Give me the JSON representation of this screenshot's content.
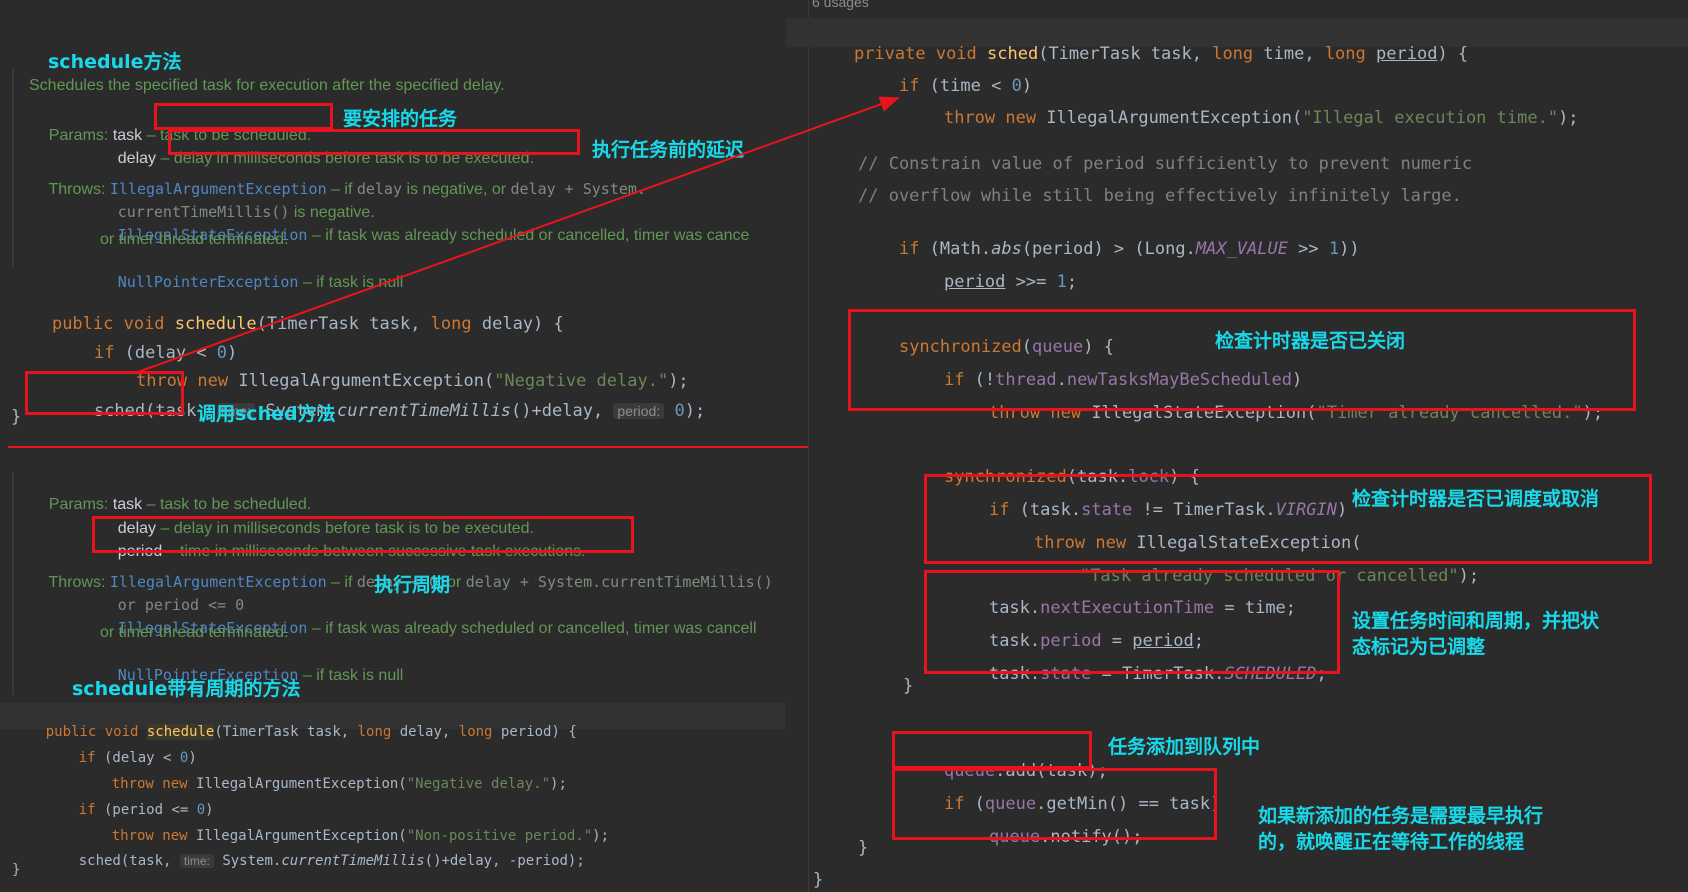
{
  "left": {
    "title1": "schedule方法",
    "doc1": {
      "summary": "Schedules the specified task for execution after the specified delay.",
      "params_label": "Params:",
      "p_task_name": "task",
      "p_task_desc": "task to be scheduled.",
      "p_delay_name": "delay",
      "p_delay_desc": "delay in milliseconds before task is to be executed.",
      "throws_label": "Throws:",
      "t1_name": "IllegalArgumentException",
      "t1_desc_a": " – if ",
      "t1_desc_b": "delay",
      "t1_desc_c": " is negative, or ",
      "t1_desc_d": "delay + System.",
      "t1_desc_e": "currentTimeMillis()",
      "t1_desc_f": " is negative.",
      "t2_name": "IllegalStateException",
      "t2_desc": " – if task was already scheduled or cancelled, timer was cance",
      "t2_desc2": "or timer thread terminated.",
      "t3_name": "NullPointerException",
      "t3_desc": " – if task is null"
    },
    "ann_task": "要安排的任务",
    "ann_delay": "执行任务前的延迟",
    "ann_sched": "调用sched方法",
    "code1": {
      "l1_a": "public void ",
      "l1_b": "schedule",
      "l1_c": "(TimerTask task, ",
      "l1_d": "long",
      "l1_e": " delay) {",
      "l2_a": "if",
      "l2_b": " (delay < ",
      "l2_c": "0",
      "l2_d": ")",
      "l3_a": "throw new ",
      "l3_b": "IllegalArgumentException(",
      "l3_c": "\"Negative delay.\"",
      "l3_d": ");",
      "l4_a": "sched(task,",
      "l4_hint_time": "time:",
      "l4_b": "System.",
      "l4_c": "currentTimeMillis",
      "l4_d": "()+delay,",
      "l4_hint_period": "period:",
      "l4_e": "0",
      "l4_f": ");",
      "l5": "}"
    },
    "doc2": {
      "params_label": "Params:",
      "p_task_name": "task",
      "p_task_desc": " – task to be scheduled.",
      "p_delay_name": "delay",
      "p_delay_desc": " – delay in milliseconds before task is to be executed.",
      "p_period_name": "period",
      "p_period_desc": " – time in milliseconds between successive task executions.",
      "throws_label": "Throws:",
      "t1_name": "IllegalArgumentException",
      "t1_desc_a": " – if ",
      "t1_desc_b": "delay < 0",
      "t1_desc_c": ", or ",
      "t1_desc_d": "delay + System.currentTimeMillis()",
      "t1_desc_e": "or period <= 0",
      "t2_name": "IllegalStateException",
      "t2_desc": " – if task was already scheduled or cancelled, timer was cancell",
      "t2_desc2": "or timer thread terminated.",
      "t3_name": "NullPointerException",
      "t3_desc": " – if task is null"
    },
    "ann_period": "执行周期",
    "title2": "schedule带有周期的方法",
    "code2": {
      "l1_a": "public void ",
      "l1_b": "schedule",
      "l1_c": "(TimerTask task, ",
      "l1_d": "long",
      "l1_e": " delay, ",
      "l1_f": "long",
      "l1_g": " period) {",
      "l2_a": "if",
      "l2_b": " (delay < ",
      "l2_c": "0",
      "l2_d": ")",
      "l3_a": "throw new ",
      "l3_b": "IllegalArgumentException(",
      "l3_c": "\"Negative delay.\"",
      "l3_d": ");",
      "l4_a": "if",
      "l4_b": " (period <= ",
      "l4_c": "0",
      "l4_d": ")",
      "l5_a": "throw new ",
      "l5_b": "IllegalArgumentException(",
      "l5_c": "\"Non-positive period.\"",
      "l5_d": ");",
      "l6_a": "sched(task,",
      "l6_hint_time": "time:",
      "l6_b": "System.",
      "l6_c": "currentTimeMillis",
      "l6_d": "()+delay, -period);",
      "l7": "}"
    }
  },
  "right": {
    "usages": "6 usages",
    "l1_a": "private void ",
    "l1_b": "sched",
    "l1_c": "(TimerTask task, ",
    "l1_d": "long",
    "l1_e": " time, ",
    "l1_f": "long",
    "l1_g": " ",
    "l1_h": "period",
    "l1_i": ") {",
    "l2_a": "if",
    "l2_b": " (time < ",
    "l2_c": "0",
    "l2_d": ")",
    "l3_a": "throw new ",
    "l3_b": "IllegalArgumentException(",
    "l3_c": "\"Illegal execution time.\"",
    "l3_d": ");",
    "c1": "// Constrain value of period sufficiently to prevent numeric",
    "c2": "// overflow while still being effectively infinitely large.",
    "l4_a": "if",
    "l4_b": " (Math.",
    "l4_c": "abs",
    "l4_d": "(period) > (Long.",
    "l4_e": "MAX_VALUE",
    "l4_f": " >> ",
    "l4_g": "1",
    "l4_h": "))",
    "l5_a": "period",
    "l5_b": " >>= ",
    "l5_c": "1",
    "l5_d": ";",
    "s1_a": "synchronized",
    "s1_b": "(",
    "s1_c": "queue",
    "s1_d": ") {",
    "s2_a": "if",
    "s2_b": " (!",
    "s2_c": "thread",
    "s2_d": ".",
    "s2_e": "newTasksMayBeScheduled",
    "s2_f": ")",
    "s3_a": "throw new ",
    "s3_b": "IllegalStateException(",
    "s3_c": "\"Timer already cancelled.\"",
    "s3_d": ");",
    "s4_a": "synchronized",
    "s4_b": "(task.",
    "s4_c": "lock",
    "s4_d": ") {",
    "s5_a": "if",
    "s5_b": " (task.",
    "s5_c": "state",
    "s5_d": " != TimerTask.",
    "s5_e": "VIRGIN",
    "s5_f": ")",
    "s6_a": "throw new ",
    "s6_b": "IllegalStateException(",
    "s7_a": "\"Task already scheduled or cancelled\"",
    "s7_b": ");",
    "s8_a": "task.",
    "s8_b": "nextExecutionTime",
    "s8_c": " = time;",
    "s9_a": "task.",
    "s9_b": "period",
    "s9_c": " = ",
    "s9_d": "period",
    "s9_e": ";",
    "s10_a": "task.",
    "s10_b": "state",
    "s10_c": " = TimerTask.",
    "s10_d": "SCHEDULED",
    "s10_e": ";",
    "s11": "}",
    "s12_a": "queue",
    "s12_b": ".add(task);",
    "s13_a": "if",
    "s13_b": " (",
    "s13_c": "queue",
    "s13_d": ".getMin() == task)",
    "s14_a": "queue",
    "s14_b": ".notify();",
    "s15": "}",
    "s16": "}",
    "ann_closed": "检查计时器是否已关闭",
    "ann_virgin": "检查计时器是否已调度或取消",
    "ann_set1": "设置任务时间和周期，并把状",
    "ann_set2": "态标记为已调整",
    "ann_add": "任务添加到队列中",
    "ann_notify1": "如果新添加的任务是需要最早执行",
    "ann_notify2": "的，就唤醒正在等待工作的线程"
  },
  "colors": {
    "annotation": "#18d9ea",
    "highlight_box": "#e8141d",
    "background": "#2b2b2b"
  }
}
